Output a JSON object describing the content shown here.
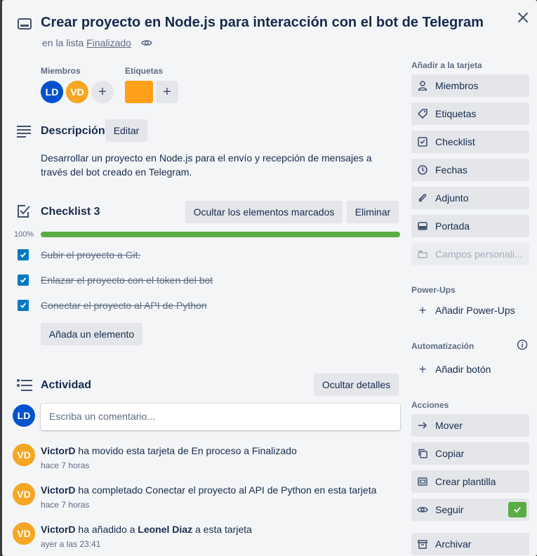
{
  "card": {
    "title": "Crear proyecto en Node.js para interacción con el bot de Telegram",
    "list_prefix": "en la lista",
    "list_name": "Finalizado"
  },
  "members": {
    "label": "Miembros",
    "avatars": [
      "LD",
      "VD"
    ]
  },
  "labels": {
    "label": "Etiquetas",
    "chip_color": "#ff9f1a"
  },
  "description": {
    "title": "Descripción",
    "edit_label": "Editar",
    "text": "Desarrollar un proyecto en Node.js para el envío y recepción de mensajes a través del bot creado en Telegram."
  },
  "checklist": {
    "title": "Checklist 3",
    "hide_checked_label": "Ocultar los elementos marcados",
    "delete_label": "Eliminar",
    "progress_text": "100%",
    "progress": 1.0,
    "items": [
      {
        "text": "Subir el proyecto a Git.",
        "checked": true
      },
      {
        "text": "Enlazar el proyecto con el token del bot",
        "checked": true
      },
      {
        "text": "Conectar el proyecto al API de Python",
        "checked": true
      }
    ],
    "add_item_label": "Añada un elemento"
  },
  "activity": {
    "title": "Actividad",
    "hide_details_label": "Ocultar detalles",
    "comment_avatar": "LD",
    "comment_placeholder": "Escriba un comentario...",
    "entries": [
      {
        "avatar": "VD",
        "user": "VictorD",
        "text": " ha movido esta tarjeta de En proceso a Finalizado",
        "time": "hace 7 horas"
      },
      {
        "avatar": "VD",
        "user": "VictorD",
        "text": " ha completado Conectar el proyecto al API de Python en esta tarjeta",
        "time": "hace 7 horas"
      },
      {
        "avatar": "VD",
        "user": "VictorD",
        "text_pre": " ha añadido a ",
        "target": "Leonel Diaz",
        "text_post": " a esta tarjeta",
        "time": "ayer a las 23:41"
      }
    ]
  },
  "sidebar": {
    "add_title": "Añadir a la tarjeta",
    "add_items": [
      {
        "label": "Miembros",
        "icon": "person-icon"
      },
      {
        "label": "Etiquetas",
        "icon": "tag-icon"
      },
      {
        "label": "Checklist",
        "icon": "checklist-icon"
      },
      {
        "label": "Fechas",
        "icon": "clock-icon"
      },
      {
        "label": "Adjunto",
        "icon": "paperclip-icon"
      },
      {
        "label": "Portada",
        "icon": "cover-icon"
      },
      {
        "label": "Campos personali...",
        "icon": "custom-fields-icon"
      }
    ],
    "powerups_title": "Power-Ups",
    "add_powerups_label": "Añadir Power-Ups",
    "automation_title": "Automatización",
    "add_button_label": "Añadir botón",
    "actions_title": "Acciones",
    "action_items": [
      {
        "label": "Mover",
        "icon": "arrow-right-icon"
      },
      {
        "label": "Copiar",
        "icon": "copy-icon"
      },
      {
        "label": "Crear plantilla",
        "icon": "template-icon"
      },
      {
        "label": "Seguir",
        "icon": "eye-icon"
      },
      {
        "label": "Archivar",
        "icon": "archive-icon"
      }
    ]
  },
  "colors": {
    "avatar_ld": "#0052cc",
    "avatar_vd": "#f5a623",
    "progress": "#5aac44",
    "checkbox": "#0079bf"
  }
}
